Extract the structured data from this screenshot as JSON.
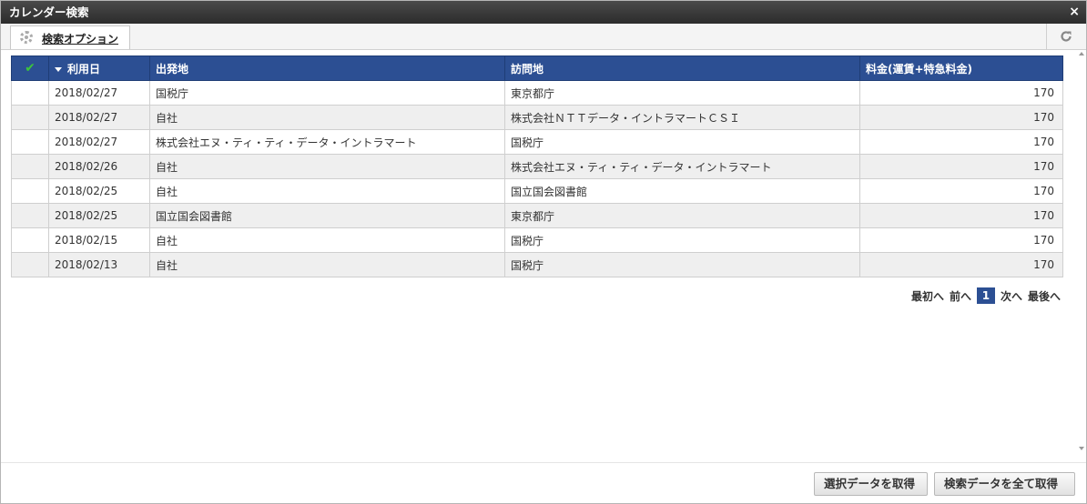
{
  "window": {
    "title": "カレンダー検索",
    "close_icon": "×"
  },
  "tab": {
    "label": "検索オプション"
  },
  "table": {
    "columns": {
      "check": "✔",
      "date": "利用日",
      "from": "出発地",
      "to": "訪問地",
      "fare": "料金(運賃+特急料金)"
    },
    "rows": [
      {
        "date": "2018/02/27",
        "from": "国税庁",
        "to": "東京都庁",
        "fare": "170"
      },
      {
        "date": "2018/02/27",
        "from": "自社",
        "to": "株式会社ＮＴＴデータ・イントラマートＣＳＩ",
        "fare": "170"
      },
      {
        "date": "2018/02/27",
        "from": "株式会社エヌ・ティ・ティ・データ・イントラマート",
        "to": "国税庁",
        "fare": "170"
      },
      {
        "date": "2018/02/26",
        "from": "自社",
        "to": "株式会社エヌ・ティ・ティ・データ・イントラマート",
        "fare": "170"
      },
      {
        "date": "2018/02/25",
        "from": "自社",
        "to": "国立国会図書館",
        "fare": "170"
      },
      {
        "date": "2018/02/25",
        "from": "国立国会図書館",
        "to": "東京都庁",
        "fare": "170"
      },
      {
        "date": "2018/02/15",
        "from": "自社",
        "to": "国税庁",
        "fare": "170"
      },
      {
        "date": "2018/02/13",
        "from": "自社",
        "to": "国税庁",
        "fare": "170"
      }
    ]
  },
  "pager": {
    "first": "最初へ",
    "prev": "前へ",
    "current": "1",
    "next": "次へ",
    "last": "最後へ"
  },
  "buttons": {
    "get_selected": "選択データを取得",
    "get_all": "検索データを全て取得"
  },
  "colors": {
    "header_bg": "#2c4f93",
    "check": "#3cc43c",
    "titlebar": "#2c2c2c"
  }
}
